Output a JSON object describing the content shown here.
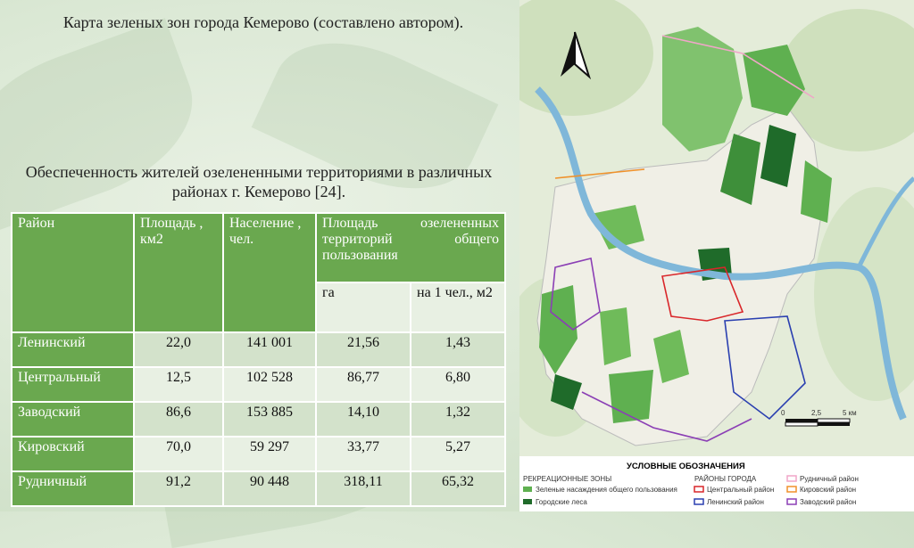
{
  "title": "Карта зеленых зон города Кемерово (составлено автором).",
  "subtitle": "Обеспеченность жителей озелененными территориями в различных районах г. Кемерово [24].",
  "table": {
    "headers": [
      "Район",
      "Площадь , км2",
      "Население , чел.",
      "Площадь озелененных территорий общего пользования"
    ],
    "subheaders": [
      "га",
      "на 1 чел., м2"
    ],
    "rows": [
      {
        "district": "Ленинский",
        "area": "22,0",
        "population": "141 001",
        "ha": "21,56",
        "per_person": "1,43"
      },
      {
        "district": "Центральный",
        "area": "12,5",
        "population": "102 528",
        "ha": "86,77",
        "per_person": "6,80"
      },
      {
        "district": "Заводский",
        "area": "86,6",
        "population": "153 885",
        "ha": "14,10",
        "per_person": "1,32"
      },
      {
        "district": "Кировский",
        "area": "70,0",
        "population": "59 297",
        "ha": "33,77",
        "per_person": "5,27"
      },
      {
        "district": "Рудничный",
        "area": "91,2",
        "population": "90 448",
        "ha": "318,11",
        "per_person": "65,32"
      }
    ]
  },
  "map": {
    "scale": {
      "zero": "0",
      "mid": "2,5",
      "end": "5 км"
    },
    "legend": {
      "title": "УСЛОВНЫЕ ОБОЗНАЧЕНИЯ",
      "recreation_heading": "РЕКРЕАЦИОННЫЕ ЗОНЫ",
      "recreation_items": [
        {
          "label": "Зеленые насаждения общего пользования",
          "color": "#5fb050"
        },
        {
          "label": "Городские леса",
          "color": "#1f6b2a"
        }
      ],
      "districts_heading": "РАЙОНЫ ГОРОДА",
      "district_items": [
        {
          "label": "Центральный район",
          "color": "#d9262a"
        },
        {
          "label": "Ленинский район",
          "color": "#2a3fb0"
        }
      ],
      "district_items_2": [
        {
          "label": "Рудничный район",
          "color": "#f0a6c8"
        },
        {
          "label": "Кировский район",
          "color": "#f0912a"
        },
        {
          "label": "Заводский район",
          "color": "#8b3fb5"
        }
      ]
    }
  }
}
